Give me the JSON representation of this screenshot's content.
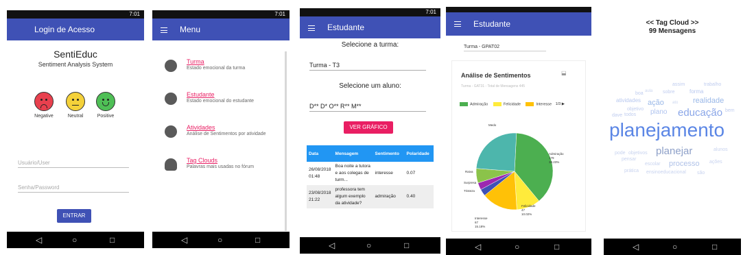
{
  "status": {
    "time": "7:01"
  },
  "login": {
    "title": "Login de Acesso",
    "app_name": "SentiEduc",
    "app_sub": "Sentiment Analysis System",
    "faces": [
      {
        "label": "Negative",
        "color": "#e8404e"
      },
      {
        "label": "Neutral",
        "color": "#f4d13a"
      },
      {
        "label": "Positive",
        "color": "#4fbf56"
      }
    ],
    "user_placeholder": "Usuário/User",
    "pass_placeholder": "Senha/Password",
    "submit": "ENTRAR"
  },
  "menu": {
    "title": "Menu",
    "items": [
      {
        "label": "Turma",
        "sub": "Estado emocional da turma",
        "icon": "group-icon"
      },
      {
        "label": "Estudante",
        "sub": "Estado emocional do estudante",
        "icon": "person-icon"
      },
      {
        "label": "Atividades",
        "sub": "Análise de Sentimentos por atividade",
        "icon": "school-icon"
      },
      {
        "label": "Tag Clouds",
        "sub": "Palavras mais usadas no fórum",
        "icon": "cloud-icon"
      }
    ]
  },
  "student": {
    "title": "Estudante",
    "select_class_label": "Selecione a turma:",
    "class_value": "Turma -  T3",
    "select_student_label": "Selecione um aluno:",
    "student_value": "D** D* O** R** M**",
    "chart_button": "VER GRÁFICO",
    "table": {
      "headers": [
        "Data",
        "Mensagem",
        "Sentimento",
        "Polaridade"
      ],
      "rows": [
        {
          "date": "26/08/2018 01:48",
          "message": "Boa noite a tutora e aos colegas de turm...",
          "sentiment": "interesse",
          "polarity": "0.07"
        },
        {
          "date": "23/08/2018 21:22",
          "message": "professora tem algum exemplo da atividade?",
          "sentiment": "admiração",
          "polarity": "0.40"
        }
      ]
    }
  },
  "chart_screen": {
    "title": "Estudante",
    "class_value": "Turma - GPAT02",
    "chart_title": "Análise de Sentimentos",
    "chart_subtitle": "Turma - GAT31 - Total de Mensagens 445",
    "legend_more": "1/3 ▶",
    "labels": [
      {
        "name": "Admiração",
        "value": "179",
        "pct": "38.23%"
      },
      {
        "name": "Felicidade",
        "value": "47",
        "pct": "10.02%"
      },
      {
        "name": "Interesse",
        "value": "67",
        "pct": "15.18%"
      },
      {
        "name": "Raiva",
        "value": "",
        "pct": ""
      },
      {
        "name": "Surpresa",
        "value": "",
        "pct": ""
      },
      {
        "name": "Tristeza",
        "value": "",
        "pct": ""
      },
      {
        "name": "Medo",
        "value": "",
        "pct": ""
      }
    ]
  },
  "chart_data": {
    "type": "pie",
    "title": "Análise de Sentimentos",
    "subtitle": "Turma - GAT31 - Total de Mensagens 445",
    "legend_position": "top",
    "series": [
      {
        "name": "Admiração",
        "value": 38.23,
        "color": "#4caf50"
      },
      {
        "name": "Felicidade",
        "value": 10.02,
        "color": "#ffeb3b"
      },
      {
        "name": "Interesse",
        "value": 15.18,
        "color": "#ffc107"
      },
      {
        "name": "",
        "value": 2.9,
        "color": "#3f51b5"
      },
      {
        "name": "",
        "value": 3.0,
        "color": "#9c27b0"
      },
      {
        "name": "",
        "value": 6.1,
        "color": "#8bc34a"
      },
      {
        "name": "",
        "value": 24.57,
        "color": "#4db6ac"
      }
    ]
  },
  "cloud": {
    "title": "<< Tag Cloud >>",
    "subtitle": "99 Mensagens",
    "words": [
      {
        "t": "planejamento",
        "size": 28,
        "color": "#5b86e5"
      },
      {
        "t": "educação",
        "size": 15,
        "color": "#8aa6e8"
      },
      {
        "t": "planejar",
        "size": 15,
        "color": "#8ea0c8"
      },
      {
        "t": "realidade",
        "size": 11,
        "color": "#9ab8e8"
      },
      {
        "t": "processo",
        "size": 11,
        "color": "#b0c2e8"
      },
      {
        "t": "ação",
        "size": 11,
        "color": "#9ab8e8"
      },
      {
        "t": "plano",
        "size": 10,
        "color": "#b0c4ef"
      },
      {
        "t": "forma",
        "size": 8,
        "color": "#b8c8ef"
      },
      {
        "t": "atividades",
        "size": 8,
        "color": "#b8c8ef"
      },
      {
        "t": "sobre",
        "size": 7,
        "color": "#c0cdef"
      },
      {
        "t": "assim",
        "size": 7,
        "color": "#c0cdef"
      },
      {
        "t": "trabalho",
        "size": 7,
        "color": "#c0cdef"
      },
      {
        "t": "boa",
        "size": 7,
        "color": "#c0cdef"
      },
      {
        "t": "bem",
        "size": 7,
        "color": "#c0cdef"
      },
      {
        "t": "dave",
        "size": 7,
        "color": "#c0cdef"
      },
      {
        "t": "todos",
        "size": 7,
        "color": "#c0cdef"
      },
      {
        "t": "objetivo",
        "size": 7,
        "color": "#c0cdef"
      },
      {
        "t": "pode",
        "size": 7,
        "color": "#c8d3ef"
      },
      {
        "t": "objetivos",
        "size": 7,
        "color": "#c8d3ef"
      },
      {
        "t": "alunos",
        "size": 7,
        "color": "#c8d3ef"
      },
      {
        "t": "pensar",
        "size": 7,
        "color": "#c8d3ef"
      },
      {
        "t": "escolar",
        "size": 7,
        "color": "#c8d3ef"
      },
      {
        "t": "ações",
        "size": 7,
        "color": "#c8d3ef"
      },
      {
        "t": "prática",
        "size": 7,
        "color": "#c8d3ef"
      },
      {
        "t": "ensinoeducacional",
        "size": 7,
        "color": "#c8d3ef"
      },
      {
        "t": "são",
        "size": 7,
        "color": "#c8d3ef"
      },
      {
        "t": "aula",
        "size": 6,
        "color": "#ccd6ef"
      },
      {
        "t": "ato",
        "size": 6,
        "color": "#ccd6ef"
      }
    ]
  }
}
